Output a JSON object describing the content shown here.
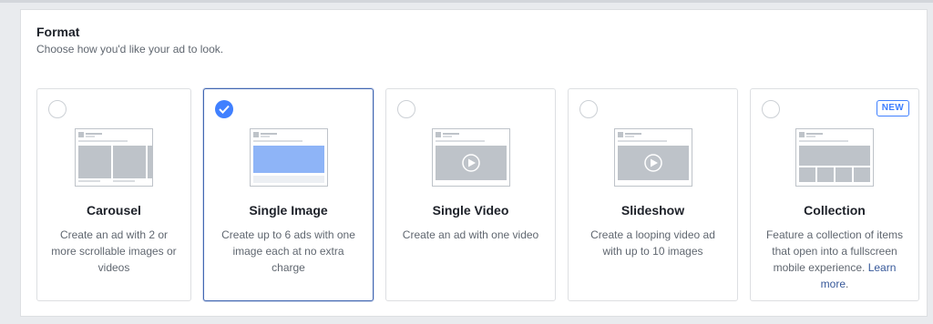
{
  "section": {
    "title": "Format",
    "subtitle": "Choose how you'd like your ad to look."
  },
  "colors": {
    "accent": "#4080ff",
    "selected_border": "#4267b2",
    "placeholder_gray": "#bec3c9",
    "text_primary": "#1d2129",
    "text_secondary": "#606770",
    "link": "#365899"
  },
  "cards": [
    {
      "id": "carousel",
      "title": "Carousel",
      "description": "Create an ad with 2 or more scrollable images or videos",
      "selected": false,
      "illustration": "carousel-preview-icon"
    },
    {
      "id": "single-image",
      "title": "Single Image",
      "description": "Create up to 6 ads with one image each at no extra charge",
      "selected": true,
      "illustration": "single-image-preview-icon"
    },
    {
      "id": "single-video",
      "title": "Single Video",
      "description": "Create an ad with one video",
      "selected": false,
      "illustration": "single-video-preview-icon"
    },
    {
      "id": "slideshow",
      "title": "Slideshow",
      "description": "Create a looping video ad with up to 10 images",
      "selected": false,
      "illustration": "slideshow-preview-icon"
    },
    {
      "id": "collection",
      "title": "Collection",
      "description": "Feature a collection of items that open into a fullscreen mobile experience.",
      "link_text": "Learn more",
      "link_suffix": ".",
      "badge": "NEW",
      "selected": false,
      "illustration": "collection-preview-icon"
    }
  ]
}
